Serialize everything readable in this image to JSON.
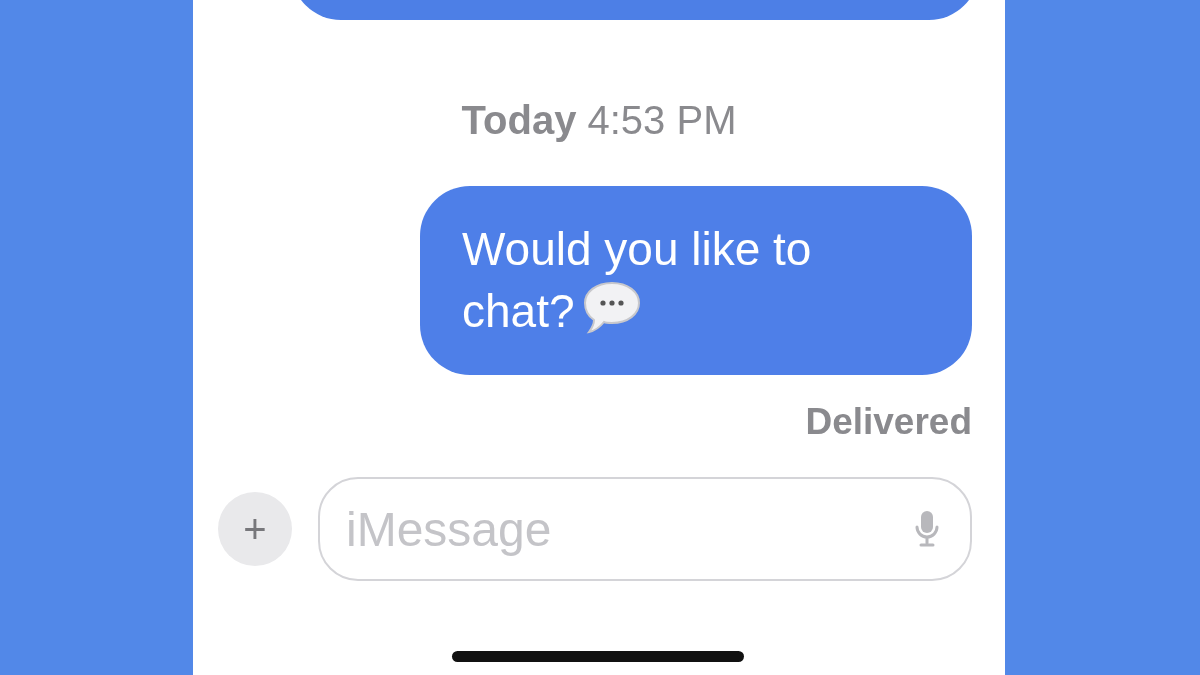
{
  "conversation": {
    "timestamp": "**Today** 4:53 PM",
    "messages": [
      {
        "kind": "partial"
      },
      {
        "kind": "sent",
        "text": "Would you like to chat?"
      }
    ],
    "status": "Delivered"
  },
  "composer": {
    "placeholder": "iMessage",
    "add_button": "+"
  }
}
